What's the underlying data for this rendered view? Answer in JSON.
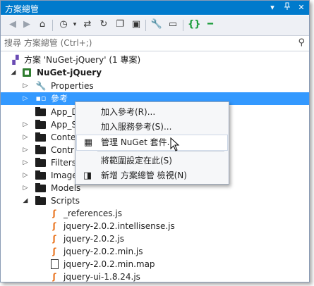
{
  "window": {
    "title": "方案總管",
    "buttons": [
      "▾",
      "⊡",
      "✕"
    ]
  },
  "toolbar": {
    "icons": [
      "back-icon",
      "forward-icon",
      "home-icon",
      "history-icon",
      "sync-icon",
      "refresh-icon",
      "collapse-all-icon",
      "show-all-files-icon",
      "properties-icon",
      "preview-icon",
      "code-icon",
      "minus-icon"
    ]
  },
  "search": {
    "placeholder": "搜尋 方案總管 (Ctrl+;)"
  },
  "tree": {
    "solution": "方案 'NuGet-jQuery' (1 專案)",
    "project": "NuGet-jQuery",
    "items": [
      "Properties",
      "參考",
      "App_Data",
      "App_Start",
      "Content",
      "Controllers",
      "Filters",
      "Images",
      "Models",
      "Scripts"
    ],
    "visible_items": [
      "Properties",
      "參考",
      "App_D",
      "App_S",
      "Conte",
      "Contr",
      "Filters",
      "Image",
      "Models",
      "Scripts"
    ],
    "scripts": [
      "_references.js",
      "jquery-2.0.2.intellisense.js",
      "jquery-2.0.2.js",
      "jquery-2.0.2.min.js",
      "jquery-2.0.2.min.map",
      "jquery-ui-1.8.24.js"
    ]
  },
  "context_menu": {
    "items": [
      {
        "label": "加入參考(R)...",
        "icon": ""
      },
      {
        "label": "加入服務參考(S)...",
        "icon": ""
      },
      {
        "label": "管理 NuGet 套件...",
        "icon": "nuget-package-icon"
      },
      {
        "label": "將範圍設定在此(S)",
        "icon": ""
      },
      {
        "label": "新增 方案總管 檢視(N)",
        "icon": "new-view-icon"
      }
    ]
  },
  "colors": {
    "accent": "#007acc",
    "selection": "#3399ff",
    "js_icon": "#e8711a"
  }
}
